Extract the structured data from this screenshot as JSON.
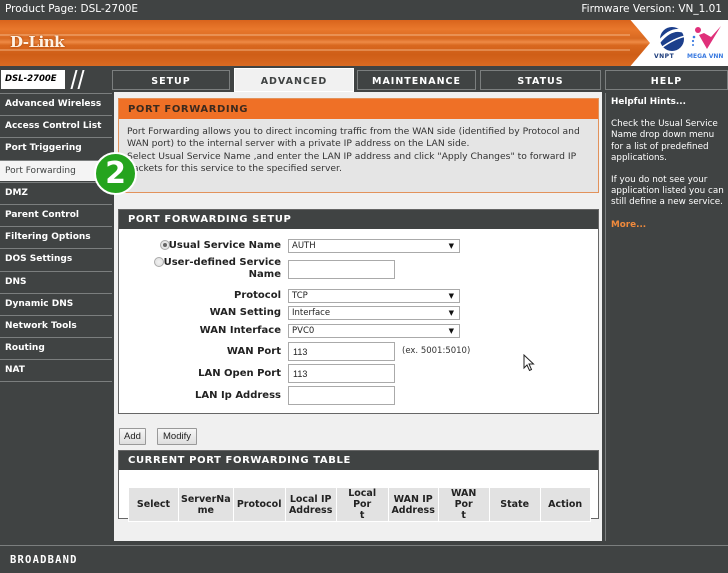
{
  "topbar": {
    "product_page": "Product Page: DSL-2700E",
    "firmware": "Firmware Version: VN_1.01"
  },
  "banner": {
    "logo": "D-Link",
    "partner_logos": [
      "VNPT",
      "MEGA VNN"
    ]
  },
  "model": "DSL-2700E",
  "tabs": [
    {
      "label": "SETUP",
      "active": false
    },
    {
      "label": "ADVANCED",
      "active": true
    },
    {
      "label": "MAINTENANCE",
      "active": false
    },
    {
      "label": "STATUS",
      "active": false
    },
    {
      "label": "HELP",
      "active": false
    }
  ],
  "sidebar": {
    "items": [
      {
        "label": "Advanced Wireless"
      },
      {
        "label": "Access Control List"
      },
      {
        "label": "Port Triggering"
      },
      {
        "label": "Port Forwarding",
        "active": true
      },
      {
        "label": "DMZ"
      },
      {
        "label": "Parent Control"
      },
      {
        "label": "Filtering Options"
      },
      {
        "label": "DOS Settings"
      },
      {
        "label": "DNS"
      },
      {
        "label": "Dynamic DNS"
      },
      {
        "label": "Network Tools"
      },
      {
        "label": "Routing"
      },
      {
        "label": "NAT"
      }
    ]
  },
  "port_forwarding": {
    "title": "PORT FORWARDING",
    "description_1": "Port Forwarding allows you to direct incoming traffic from the WAN side (identified by Protocol and WAN port) to the internal server with a private IP address on the LAN side.",
    "description_2": "Select Usual Service Name ,and enter the LAN IP address and click \"Apply Changes\" to forward IP packets for this service to the specified server."
  },
  "setup": {
    "title": "PORT FORWARDING SETUP",
    "usual_service_label": "Usual Service Name",
    "usual_service_value": "AUTH",
    "user_defined_label_1": "User-defined Service",
    "user_defined_label_2": "Name",
    "user_defined_value": "",
    "protocol_label": "Protocol",
    "protocol_value": "TCP",
    "wan_setting_label": "WAN Setting",
    "wan_setting_value": "Interface",
    "wan_interface_label": "WAN Interface",
    "wan_interface_value": "PVC0",
    "wan_port_label": "WAN Port",
    "wan_port_value": "113",
    "wan_port_hint": "(ex. 5001:5010)",
    "lan_open_port_label": "LAN Open Port",
    "lan_open_port_value": "113",
    "lan_ip_label": "LAN Ip Address",
    "lan_ip_value": "",
    "selected_radio": "usual_service"
  },
  "buttons": {
    "add": "Add",
    "modify": "Modify"
  },
  "table": {
    "title": "CURRENT PORT FORWARDING TABLE",
    "headers": [
      [
        "Select"
      ],
      [
        "ServerNa",
        "me"
      ],
      [
        "Protocol"
      ],
      [
        "Local IP",
        "Address"
      ],
      [
        "Local Por",
        "t"
      ],
      [
        "WAN IP",
        "Address"
      ],
      [
        "WAN Por",
        "t"
      ],
      [
        "State"
      ],
      [
        "Action"
      ]
    ],
    "rows": []
  },
  "hints": {
    "title": "Helpful Hints...",
    "p1": "Check the Usual Service Name drop down menu for a list of predefined applications.",
    "p2": "If you do not see your application listed you can still define a new service.",
    "more": "More..."
  },
  "footer": "BROADBAND",
  "step_badge": "2",
  "colors": {
    "dark": "#404343",
    "orange": "#ef7026",
    "more_link": "#f08a3c",
    "badge_green": "#25a41e"
  }
}
